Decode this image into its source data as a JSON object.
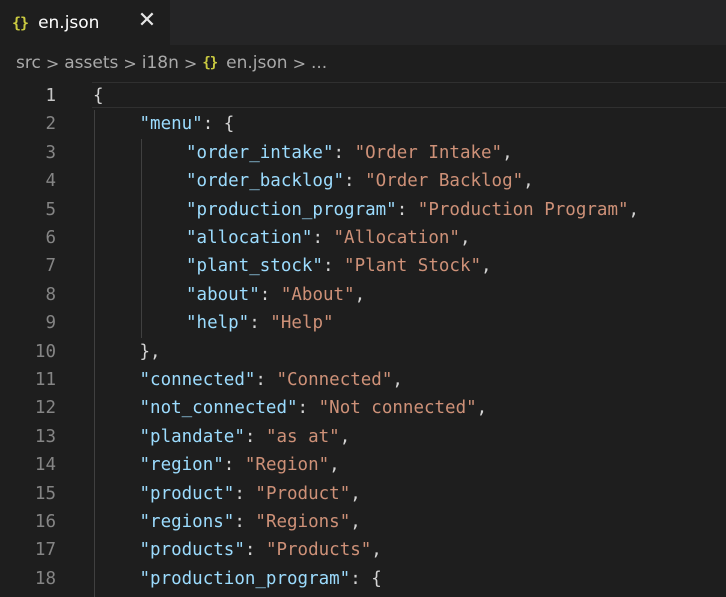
{
  "tab": {
    "icon": "json-braces-icon",
    "icon_text": "{}",
    "title": "en.json",
    "close_glyph": "✕"
  },
  "breadcrumb": {
    "items": [
      "src",
      "assets",
      "i18n"
    ],
    "file_icon_text": "{}",
    "file": "en.json",
    "ellipsis": "..."
  },
  "editor": {
    "active_line": 1,
    "lines": [
      {
        "n": "1",
        "indent": 0,
        "parts": [
          {
            "t": "p",
            "v": "{"
          }
        ]
      },
      {
        "n": "2",
        "indent": 1,
        "parts": [
          {
            "t": "k",
            "v": "\"menu\""
          },
          {
            "t": "p",
            "v": ": {"
          }
        ]
      },
      {
        "n": "3",
        "indent": 2,
        "parts": [
          {
            "t": "k",
            "v": "\"order_intake\""
          },
          {
            "t": "p",
            "v": ": "
          },
          {
            "t": "s",
            "v": "\"Order Intake\""
          },
          {
            "t": "p",
            "v": ","
          }
        ]
      },
      {
        "n": "4",
        "indent": 2,
        "parts": [
          {
            "t": "k",
            "v": "\"order_backlog\""
          },
          {
            "t": "p",
            "v": ": "
          },
          {
            "t": "s",
            "v": "\"Order Backlog\""
          },
          {
            "t": "p",
            "v": ","
          }
        ]
      },
      {
        "n": "5",
        "indent": 2,
        "parts": [
          {
            "t": "k",
            "v": "\"production_program\""
          },
          {
            "t": "p",
            "v": ": "
          },
          {
            "t": "s",
            "v": "\"Production Program\""
          },
          {
            "t": "p",
            "v": ","
          }
        ]
      },
      {
        "n": "6",
        "indent": 2,
        "parts": [
          {
            "t": "k",
            "v": "\"allocation\""
          },
          {
            "t": "p",
            "v": ": "
          },
          {
            "t": "s",
            "v": "\"Allocation\""
          },
          {
            "t": "p",
            "v": ","
          }
        ]
      },
      {
        "n": "7",
        "indent": 2,
        "parts": [
          {
            "t": "k",
            "v": "\"plant_stock\""
          },
          {
            "t": "p",
            "v": ": "
          },
          {
            "t": "s",
            "v": "\"Plant Stock\""
          },
          {
            "t": "p",
            "v": ","
          }
        ]
      },
      {
        "n": "8",
        "indent": 2,
        "parts": [
          {
            "t": "k",
            "v": "\"about\""
          },
          {
            "t": "p",
            "v": ": "
          },
          {
            "t": "s",
            "v": "\"About\""
          },
          {
            "t": "p",
            "v": ","
          }
        ]
      },
      {
        "n": "9",
        "indent": 2,
        "parts": [
          {
            "t": "k",
            "v": "\"help\""
          },
          {
            "t": "p",
            "v": ": "
          },
          {
            "t": "s",
            "v": "\"Help\""
          }
        ]
      },
      {
        "n": "10",
        "indent": 1,
        "parts": [
          {
            "t": "p",
            "v": "},"
          }
        ]
      },
      {
        "n": "11",
        "indent": 1,
        "parts": [
          {
            "t": "k",
            "v": "\"connected\""
          },
          {
            "t": "p",
            "v": ": "
          },
          {
            "t": "s",
            "v": "\"Connected\""
          },
          {
            "t": "p",
            "v": ","
          }
        ]
      },
      {
        "n": "12",
        "indent": 1,
        "parts": [
          {
            "t": "k",
            "v": "\"not_connected\""
          },
          {
            "t": "p",
            "v": ": "
          },
          {
            "t": "s",
            "v": "\"Not connected\""
          },
          {
            "t": "p",
            "v": ","
          }
        ]
      },
      {
        "n": "13",
        "indent": 1,
        "parts": [
          {
            "t": "k",
            "v": "\"plandate\""
          },
          {
            "t": "p",
            "v": ": "
          },
          {
            "t": "s",
            "v": "\"as at\""
          },
          {
            "t": "p",
            "v": ","
          }
        ]
      },
      {
        "n": "14",
        "indent": 1,
        "parts": [
          {
            "t": "k",
            "v": "\"region\""
          },
          {
            "t": "p",
            "v": ": "
          },
          {
            "t": "s",
            "v": "\"Region\""
          },
          {
            "t": "p",
            "v": ","
          }
        ]
      },
      {
        "n": "15",
        "indent": 1,
        "parts": [
          {
            "t": "k",
            "v": "\"product\""
          },
          {
            "t": "p",
            "v": ": "
          },
          {
            "t": "s",
            "v": "\"Product\""
          },
          {
            "t": "p",
            "v": ","
          }
        ]
      },
      {
        "n": "16",
        "indent": 1,
        "parts": [
          {
            "t": "k",
            "v": "\"regions\""
          },
          {
            "t": "p",
            "v": ": "
          },
          {
            "t": "s",
            "v": "\"Regions\""
          },
          {
            "t": "p",
            "v": ","
          }
        ]
      },
      {
        "n": "17",
        "indent": 1,
        "parts": [
          {
            "t": "k",
            "v": "\"products\""
          },
          {
            "t": "p",
            "v": ": "
          },
          {
            "t": "s",
            "v": "\"Products\""
          },
          {
            "t": "p",
            "v": ","
          }
        ]
      },
      {
        "n": "18",
        "indent": 1,
        "parts": [
          {
            "t": "k",
            "v": "\"production_program\""
          },
          {
            "t": "p",
            "v": ": {"
          }
        ]
      }
    ]
  },
  "colors": {
    "background": "#1e1e1e",
    "tabbar": "#252526",
    "json_key": "#9cdcfe",
    "json_string": "#ce9178",
    "punctuation": "#d4d4d4",
    "line_number": "#858585",
    "json_icon": "#cbcb41"
  }
}
